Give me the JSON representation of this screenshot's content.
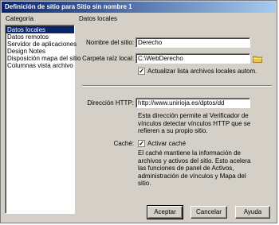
{
  "window": {
    "title": "Definición de sitio para Sitio sin nombre 1"
  },
  "sidebar": {
    "heading": "Categoría",
    "items": [
      {
        "label": "Datos locales",
        "selected": true
      },
      {
        "label": "Datos remotos",
        "selected": false
      },
      {
        "label": "Servidor de aplicaciones",
        "selected": false
      },
      {
        "label": "Design Notes",
        "selected": false
      },
      {
        "label": "Disposición mapa del sitio",
        "selected": false
      },
      {
        "label": "Columnas vista archivo",
        "selected": false
      }
    ]
  },
  "panel": {
    "heading": "Datos locales",
    "site_name_label": "Nombre del sitio:",
    "site_name_value": "Derecho",
    "root_folder_label": "Carpeta raíz local:",
    "root_folder_value": "C:\\WebDerecho",
    "refresh_list_label": "Actualizar lista archivos locales autom.",
    "refresh_list_checked": true,
    "http_label": "Dirección HTTP:",
    "http_value": "http://www.unirioja.es/dptos/dd",
    "http_help": "Esta dirección permite al Verificador de vínculos detectar vínculos HTTP que se refieren a su propio sitio.",
    "cache_label": "Caché:",
    "cache_checkbox_label": "Activar caché",
    "cache_checked": true,
    "cache_help": "El caché mantiene la información de archivos y activos del sitio. Esto acelera las funciones de panel de Activos, administración de vínculos y Mapa del sitio."
  },
  "buttons": {
    "ok": "Aceptar",
    "cancel": "Cancelar",
    "help": "Ayuda"
  },
  "colors": {
    "title_bar": "#0a246a",
    "selection": "#0a246a",
    "dialog_bg": "#d4d0c8",
    "folder_icon": "#e8c84a"
  }
}
